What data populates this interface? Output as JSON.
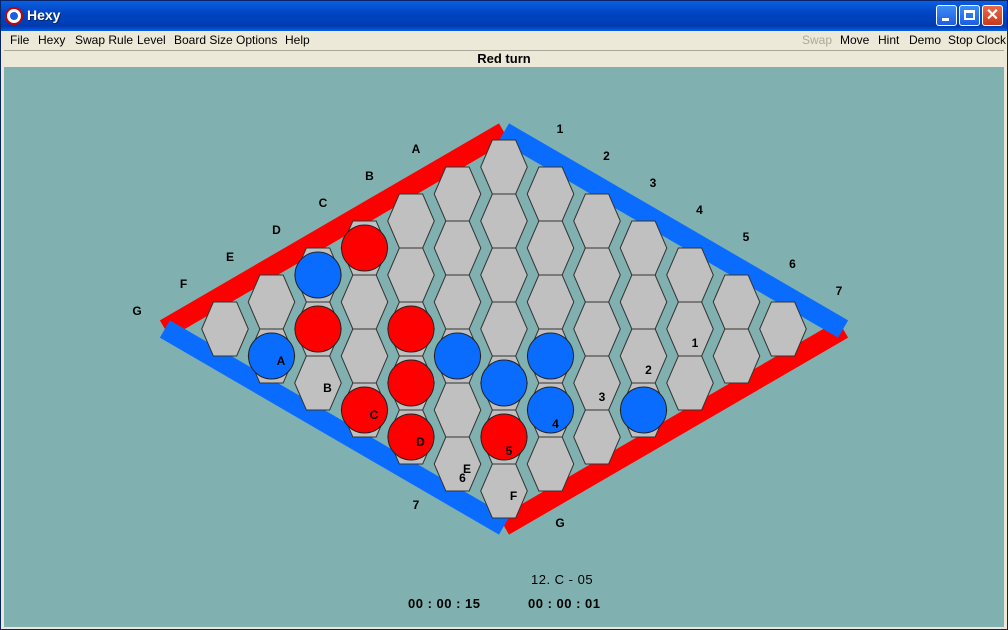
{
  "window": {
    "title": "Hexy"
  },
  "menu": {
    "left": [
      "File",
      "Hexy",
      "Swap Rule",
      "Level",
      "Board Size",
      "Options",
      "Help"
    ],
    "right": [
      "Swap",
      "Move",
      "Hint",
      "Demo",
      "Stop Clock"
    ],
    "disabled": [
      "Swap"
    ]
  },
  "status": {
    "turn_text": "Red turn"
  },
  "board": {
    "size": 7,
    "letters": [
      "A",
      "B",
      "C",
      "D",
      "E",
      "F",
      "G"
    ],
    "numbers": [
      "1",
      "2",
      "3",
      "4",
      "5",
      "6",
      "7"
    ],
    "colors": {
      "red": "#ff0000",
      "blue": "#0a6cff",
      "cell": "#c0c0c0",
      "background": "#80b0b0"
    },
    "red_stones": [
      [
        3,
        0
      ],
      [
        5,
        1
      ],
      [
        4,
        2
      ],
      [
        5,
        3
      ],
      [
        6,
        3
      ],
      [
        6,
        4
      ],
      [
        5,
        5
      ]
    ],
    "blue_stones": [
      [
        4,
        0
      ],
      [
        6,
        1
      ],
      [
        4,
        3
      ],
      [
        3,
        4
      ],
      [
        4,
        4
      ],
      [
        4,
        5
      ],
      [
        3,
        6
      ]
    ]
  },
  "footer": {
    "move_text": "12.  C - 05",
    "clock_red": "00 : 00 : 15",
    "clock_blue": "00 : 00 : 01"
  }
}
